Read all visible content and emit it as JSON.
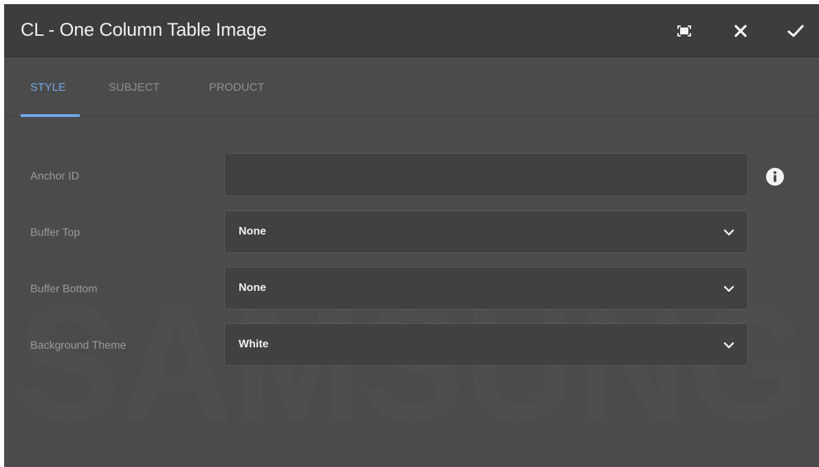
{
  "dialog": {
    "title": "CL - One Column Table Image",
    "buttons": {
      "fullscreen_icon": "fullscreen-icon",
      "close_icon": "close-icon",
      "done_icon": "check-icon"
    }
  },
  "tabs": [
    {
      "label": "STYLE",
      "active": true
    },
    {
      "label": "SUBJECT",
      "active": false
    },
    {
      "label": "PRODUCT",
      "active": false
    }
  ],
  "form": {
    "anchor_id": {
      "label": "Anchor ID",
      "value": "",
      "placeholder": ""
    },
    "buffer_top": {
      "label": "Buffer Top",
      "value": "None"
    },
    "buffer_bottom": {
      "label": "Buffer Bottom",
      "value": "None"
    },
    "background_theme": {
      "label": "Background Theme",
      "value": "White"
    }
  },
  "watermark_text": "SAMSUNG",
  "colors": {
    "header_bg": "#3d3d3d",
    "body_bg": "#4b4b4b",
    "accent": "#6fa9ea"
  }
}
